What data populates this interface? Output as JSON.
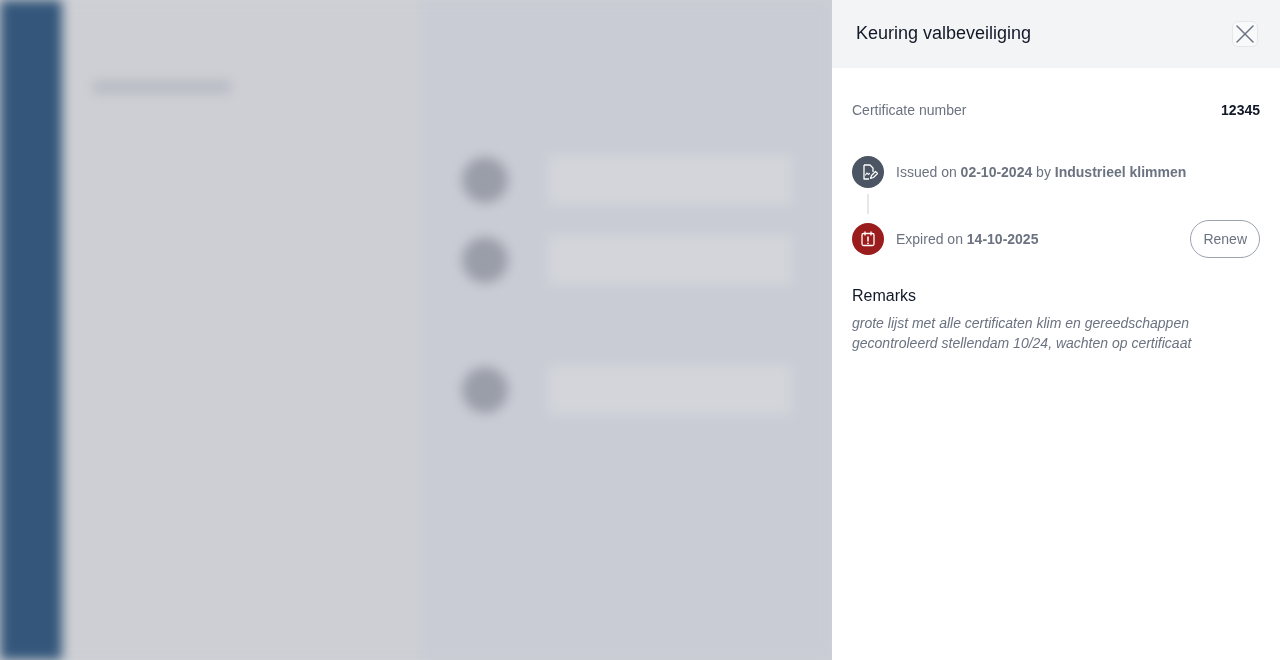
{
  "drawer": {
    "title": "Keuring valbeveiliging",
    "fields": [
      {
        "label": "Certificate number",
        "value": "12345"
      }
    ],
    "timeline": [
      {
        "kind": "issued",
        "text": "Issued on **02-10-2024** by **Industrieel klimmen**"
      },
      {
        "kind": "expired",
        "text": "Expired on **14-10-2025**",
        "action": "Renew"
      }
    ],
    "remarks": {
      "heading": "Remarks",
      "text": "grote lijst met alle certificaten klim en gereedschappen gecontroleerd stellendam 10/24, wachten op certificaat"
    }
  }
}
